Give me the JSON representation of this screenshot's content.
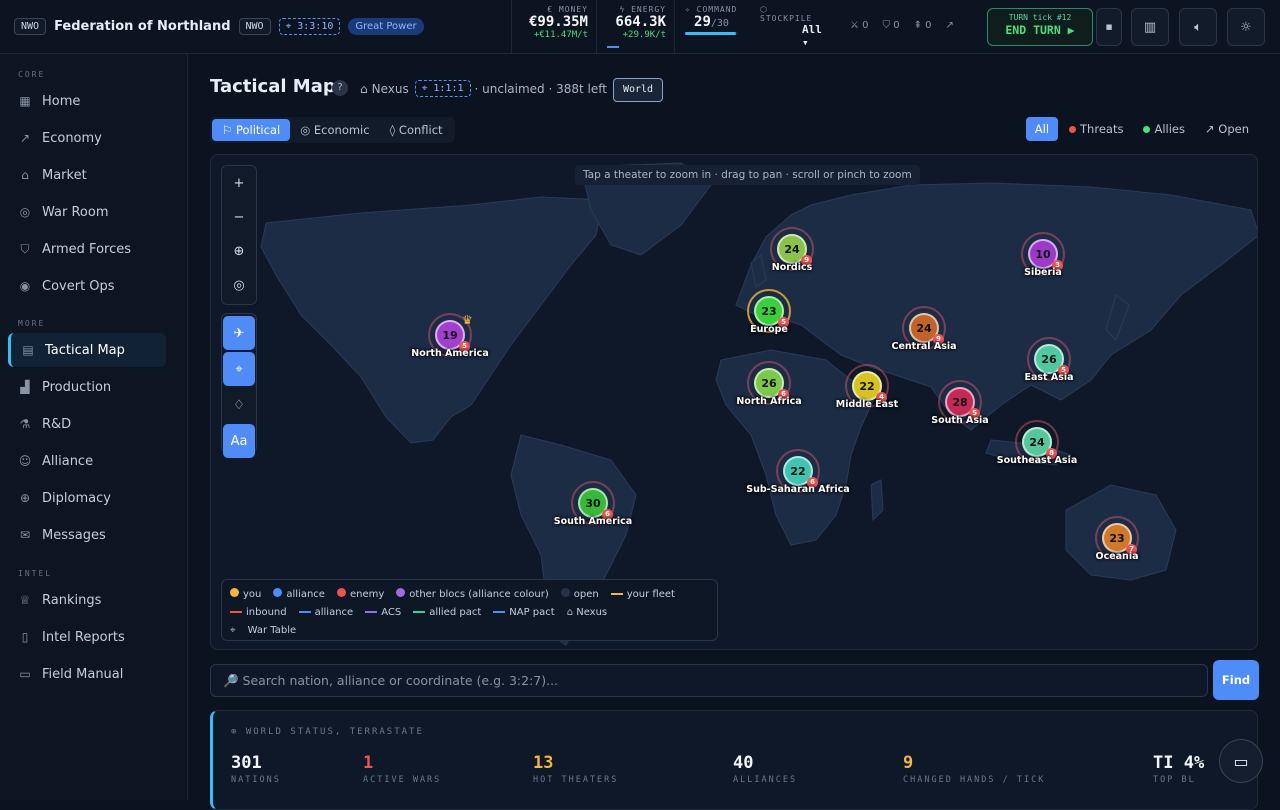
{
  "topbar": {
    "tag": "NWO",
    "nation_name": "Federation of Northland",
    "tag2": "NWO",
    "coord": "3:3:10",
    "rank_badge": "Great Power",
    "money": {
      "label": "€ MONEY",
      "value": "€99.35M",
      "delta": "+€11.47M/t"
    },
    "energy": {
      "label": "ENERGY",
      "value": "664.3K",
      "delta": "+29.9K/t"
    },
    "command": {
      "label": "COMMAND",
      "value": "29",
      "max": "/30",
      "fill_fraction": 0.97
    },
    "stockpile": {
      "label": "STOCKPILE",
      "value": "All ▾"
    },
    "counters": [
      "0",
      "0",
      "0"
    ],
    "turn": {
      "label": "TURN tick #12",
      "button": "END TURN ▶"
    }
  },
  "sidebar": {
    "sections": [
      "CORE",
      "MORE",
      "INTEL"
    ],
    "core": [
      {
        "label": "Home",
        "icon": "grid-icon"
      },
      {
        "label": "Economy",
        "icon": "trend-icon"
      },
      {
        "label": "Market",
        "icon": "bag-icon"
      },
      {
        "label": "War Room",
        "icon": "target-icon"
      },
      {
        "label": "Armed Forces",
        "icon": "shield-icon"
      },
      {
        "label": "Covert Ops",
        "icon": "eye-icon"
      }
    ],
    "more": [
      {
        "label": "Tactical Map",
        "icon": "map-icon"
      },
      {
        "label": "Production",
        "icon": "factory-icon"
      },
      {
        "label": "R&D",
        "icon": "flask-icon"
      },
      {
        "label": "Alliance",
        "icon": "users-icon"
      },
      {
        "label": "Diplomacy",
        "icon": "globe-icon"
      },
      {
        "label": "Messages",
        "icon": "mail-icon"
      }
    ],
    "intel": [
      {
        "label": "Rankings",
        "icon": "trophy-icon"
      },
      {
        "label": "Intel Reports",
        "icon": "doc-icon"
      },
      {
        "label": "Field Manual",
        "icon": "book-icon"
      }
    ]
  },
  "main": {
    "title": "Tactical Map",
    "help": "?",
    "nexus_label": "Nexus",
    "nexus_coord": "1:1:1",
    "nexus_status": "· unclaimed · 388t left",
    "world_button": "World",
    "modes": [
      "Political",
      "Economic",
      "Conflict"
    ],
    "filters": [
      "All",
      "Threats",
      "Allies",
      "Open"
    ],
    "hint": "Tap a theater to zoom in · drag to pan · scroll or pinch to zoom",
    "theaters": [
      {
        "name": "North America",
        "count": "19",
        "badge": "5",
        "color": "#a23fd0",
        "crown": true
      },
      {
        "name": "Nordics",
        "count": "24",
        "badge": "9",
        "color": "#8bc34a"
      },
      {
        "name": "Siberia",
        "count": "10",
        "badge": "3",
        "color": "#9c39c9"
      },
      {
        "name": "Europe",
        "count": "23",
        "badge": "5",
        "color": "#3bcf3b",
        "home": true
      },
      {
        "name": "Central Asia",
        "count": "24",
        "badge": "9",
        "color": "#c0642c"
      },
      {
        "name": "East Asia",
        "count": "26",
        "badge": "5",
        "color": "#4fc9a0"
      },
      {
        "name": "North Africa",
        "count": "26",
        "badge": "6",
        "color": "#7cc84a"
      },
      {
        "name": "Middle East",
        "count": "22",
        "badge": "4",
        "color": "#d4c41f"
      },
      {
        "name": "South Asia",
        "count": "28",
        "badge": "5",
        "color": "#c7285a"
      },
      {
        "name": "Southeast Asia",
        "count": "24",
        "badge": "8",
        "color": "#56c79a"
      },
      {
        "name": "Sub-Saharan Africa",
        "count": "22",
        "badge": "6",
        "color": "#3ec4b0"
      },
      {
        "name": "South America",
        "count": "30",
        "badge": "6",
        "color": "#36b83a"
      },
      {
        "name": "Oceania",
        "count": "23",
        "badge": "7",
        "color": "#d0792b"
      }
    ],
    "legend": {
      "row1": [
        {
          "label": "you",
          "color": "#f4b63f",
          "kind": "dot"
        },
        {
          "label": "alliance",
          "color": "#4f8cf7",
          "kind": "dot"
        },
        {
          "label": "enemy",
          "color": "#ef5350",
          "kind": "dot"
        },
        {
          "label": "other blocs (alliance colour)",
          "color": "#9d6be0",
          "kind": "dot"
        },
        {
          "label": "open",
          "color": "#26324a",
          "kind": "dot"
        },
        {
          "label": "your fleet",
          "color": "#f4b63f",
          "kind": "dash"
        }
      ],
      "row2": [
        {
          "label": "inbound",
          "color": "#ef5350",
          "kind": "dash"
        },
        {
          "label": "alliance",
          "color": "#4f8cf7",
          "kind": "dash"
        },
        {
          "label": "ACS",
          "color": "#9d6be0",
          "kind": "dash"
        },
        {
          "label": "allied pact",
          "color": "#34d399",
          "kind": "line"
        },
        {
          "label": "NAP pact",
          "color": "#4f8cf7",
          "kind": "dash"
        },
        {
          "label": "Nexus",
          "color": "#aab5c6",
          "kind": "icon"
        }
      ],
      "row3": "War Table"
    },
    "search_placeholder": "🔎 Search nation, alliance or coordinate (e.g. 3:2:7)...",
    "find_button": "Find",
    "world_status": {
      "title": "WORLD STATUS, TERRASTATE",
      "stats": [
        {
          "value": "301",
          "label": "NATIONS",
          "color": "#f2f5f9"
        },
        {
          "value": "1",
          "label": "ACTIVE WARS",
          "color": "#ef5350"
        },
        {
          "value": "13",
          "label": "HOT THEATERS",
          "color": "#f4b63f"
        },
        {
          "value": "40",
          "label": "ALLIANCES",
          "color": "#f2f5f9"
        },
        {
          "value": "9",
          "label": "CHANGED HANDS / TICK",
          "color": "#f4b63f"
        },
        {
          "value": "TI 4%",
          "label": "TOP BL",
          "color": "#f2f5f9"
        }
      ]
    }
  }
}
